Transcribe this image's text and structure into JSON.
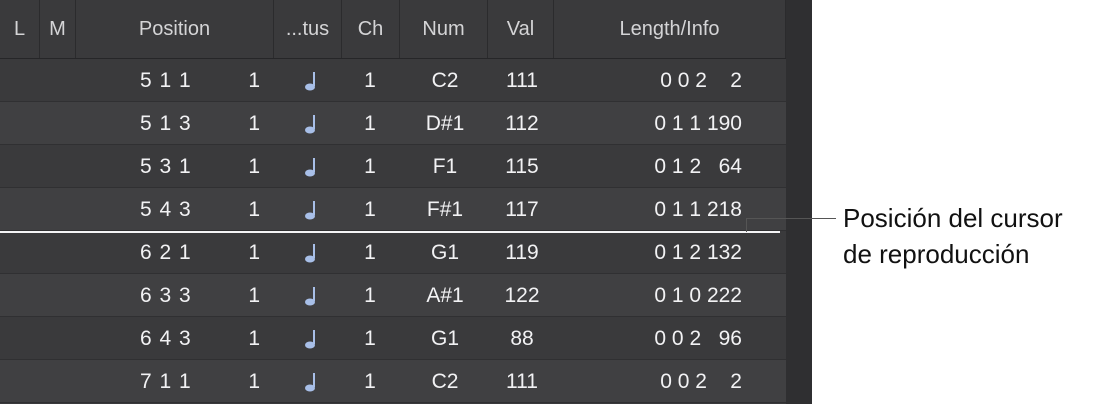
{
  "headers": {
    "l": "L",
    "m": "M",
    "position": "Position",
    "status": "...tus",
    "ch": "Ch",
    "num": "Num",
    "val": "Val",
    "length": "Length/Info"
  },
  "rows": [
    {
      "position": "5 1 1",
      "tick": "1",
      "ch": "1",
      "num": "C2",
      "val": "111",
      "length": "0 0 2    2"
    },
    {
      "position": "5 1 3",
      "tick": "1",
      "ch": "1",
      "num": "D#1",
      "val": "112",
      "length": "0 1 1 190"
    },
    {
      "position": "5 3 1",
      "tick": "1",
      "ch": "1",
      "num": "F1",
      "val": "115",
      "length": "0 1 2   64"
    },
    {
      "position": "5 4 3",
      "tick": "1",
      "ch": "1",
      "num": "F#1",
      "val": "117",
      "length": "0 1 1 218"
    },
    {
      "position": "6 2 1",
      "tick": "1",
      "ch": "1",
      "num": "G1",
      "val": "119",
      "length": "0 1 2 132"
    },
    {
      "position": "6 3 3",
      "tick": "1",
      "ch": "1",
      "num": "A#1",
      "val": "122",
      "length": "0 1 0 222"
    },
    {
      "position": "6 4 3",
      "tick": "1",
      "ch": "1",
      "num": "G1",
      "val": "88",
      "length": "0 0 2   96"
    },
    {
      "position": "7 1 1",
      "tick": "1",
      "ch": "1",
      "num": "C2",
      "val": "111",
      "length": "0 0 2    2"
    }
  ],
  "note_icon": "quarter-note-icon",
  "callout": {
    "line1": "Posición del cursor",
    "line2": "de reproducción"
  }
}
